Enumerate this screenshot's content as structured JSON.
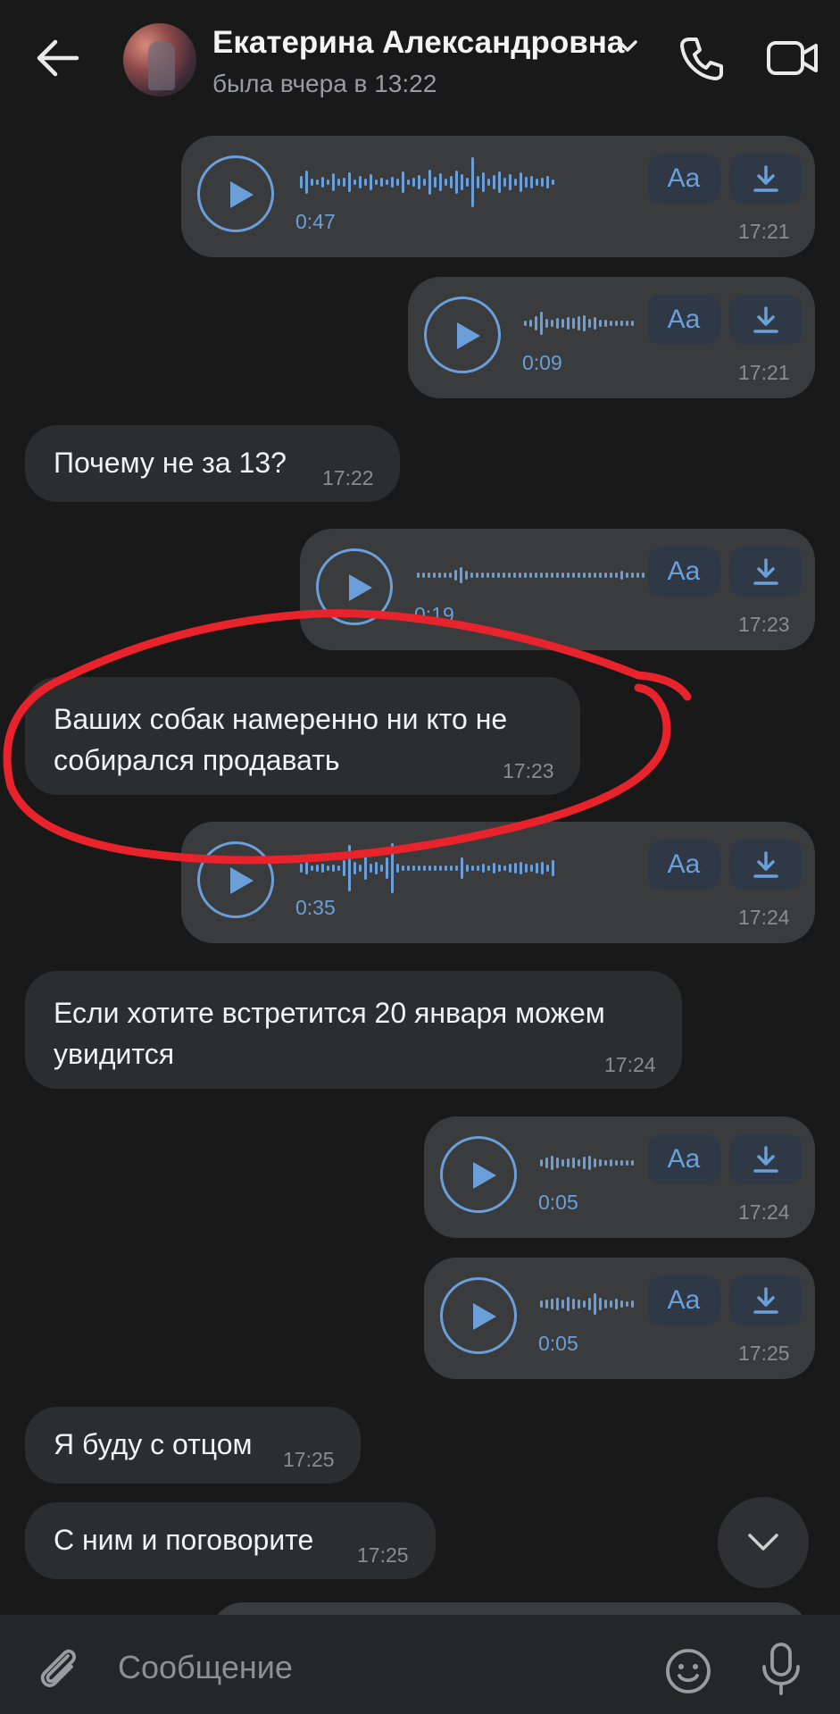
{
  "header": {
    "contact_name": "Екатерина Александровна",
    "status": "была вчера в 13:22",
    "icons": [
      "back-arrow-icon",
      "chevron-down-icon",
      "phone-icon",
      "video-camera-icon"
    ]
  },
  "messages": [
    {
      "type": "voice",
      "direction": "out",
      "duration": "0:47",
      "time": "17:21",
      "transcribe_label": "Aa"
    },
    {
      "type": "voice",
      "direction": "out",
      "duration": "0:09",
      "time": "17:21",
      "transcribe_label": "Aa"
    },
    {
      "type": "text",
      "direction": "in",
      "text": "Почему не за 13?",
      "time": "17:22"
    },
    {
      "type": "voice",
      "direction": "out",
      "duration": "0:19",
      "time": "17:23",
      "transcribe_label": "Aa"
    },
    {
      "type": "text",
      "direction": "in",
      "text": "Ваших собак намеренно ни кто не\nсобирался продавать",
      "time": "17:23"
    },
    {
      "type": "voice",
      "direction": "out",
      "duration": "0:35",
      "time": "17:24",
      "transcribe_label": "Aa"
    },
    {
      "type": "text",
      "direction": "in",
      "text": "Если хотите встретится 20 января можем\nувидится",
      "time": "17:24"
    },
    {
      "type": "voice",
      "direction": "out",
      "duration": "0:05",
      "time": "17:24",
      "transcribe_label": "Aa"
    },
    {
      "type": "voice",
      "direction": "out",
      "duration": "0:05",
      "time": "17:25",
      "transcribe_label": "Aa"
    },
    {
      "type": "text",
      "direction": "in",
      "text": "Я буду с отцом",
      "time": "17:25"
    },
    {
      "type": "text",
      "direction": "in",
      "text": "С ним и поговорите",
      "time": "17:25"
    }
  ],
  "composer": {
    "placeholder": "Сообщение",
    "icons": [
      "attach-paperclip-icon",
      "emoji-icon",
      "microphone-icon"
    ]
  },
  "colors": {
    "background": "#19191a",
    "bubble_out": "#3a3b3d",
    "bubble_in": "#2c2d2f",
    "accent": "#6a9fda",
    "annotation": "#e8232b"
  }
}
